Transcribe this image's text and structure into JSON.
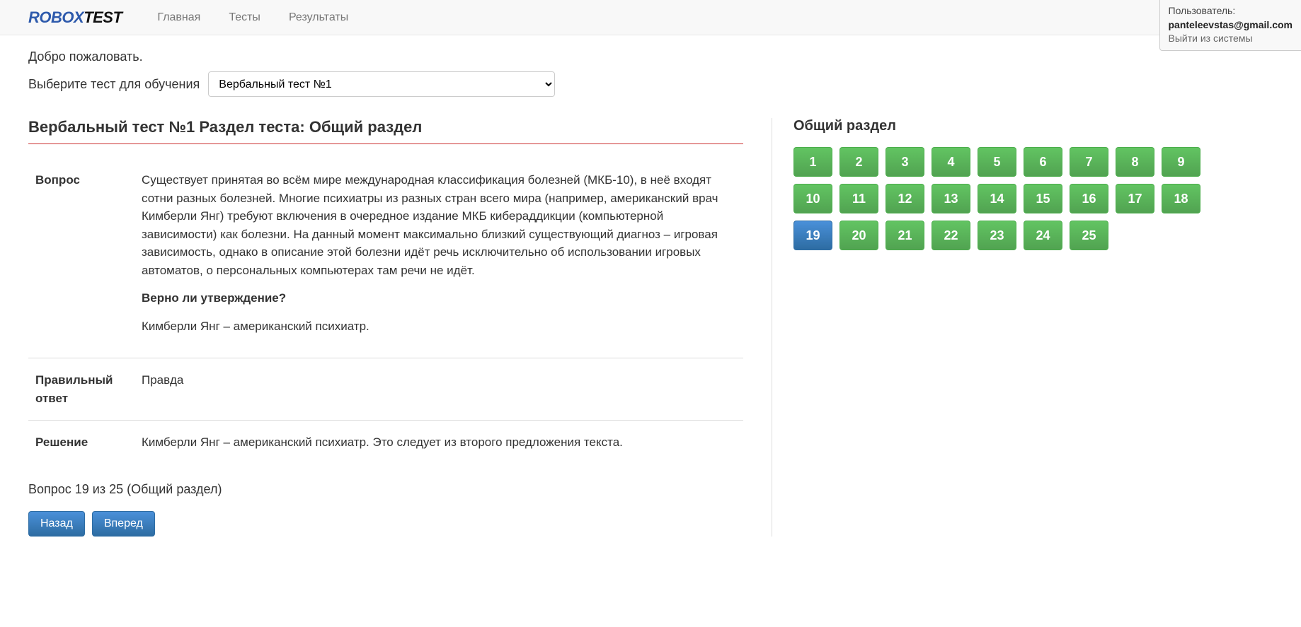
{
  "brand": {
    "part1": "ROBOX",
    "part2": "TEST"
  },
  "nav": {
    "home": "Главная",
    "tests": "Тесты",
    "results": "Результаты"
  },
  "user": {
    "label": "Пользователь:",
    "email": "panteleevstas@gmail.com",
    "logout": "Выйти из системы"
  },
  "welcome": "Добро пожаловать.",
  "select_label": "Выберите тест для обучения",
  "select_value": "Вербальный тест №1",
  "section_title": "Вербальный тест №1 Раздел теста: Общий раздел",
  "question": {
    "label": "Вопрос",
    "passage": "Существует принятая во всём мире международная классификация болезней (МКБ-10), в неё входят сотни разных болезней. Многие психиатры из разных стран всего мира (например, американский врач Кимберли Янг) требуют включения в очередное издание МКБ кибераддикции (компьютерной зависимости) как болезни. На данный момент максимально близкий существующий диагноз – игровая зависимость, однако в описание этой болезни идёт речь исключительно об использовании игровых автоматов, о персональных компьютерах там речи не идёт.",
    "prompt": "Верно ли утверждение?",
    "statement": "Кимберли Янг – американский психиатр."
  },
  "answer": {
    "label": "Правильный ответ",
    "value": "Правда"
  },
  "solution": {
    "label": "Решение",
    "value": "Кимберли Янг – американский психиатр. Это следует из второго предложения текста."
  },
  "progress": "Вопрос 19 из 25 (Общий раздел)",
  "buttons": {
    "back": "Назад",
    "forward": "Вперед"
  },
  "sidebar": {
    "title": "Общий раздел",
    "current": 19,
    "total": 25,
    "cells": [
      "1",
      "2",
      "3",
      "4",
      "5",
      "6",
      "7",
      "8",
      "9",
      "10",
      "11",
      "12",
      "13",
      "14",
      "15",
      "16",
      "17",
      "18",
      "19",
      "20",
      "21",
      "22",
      "23",
      "24",
      "25"
    ]
  }
}
